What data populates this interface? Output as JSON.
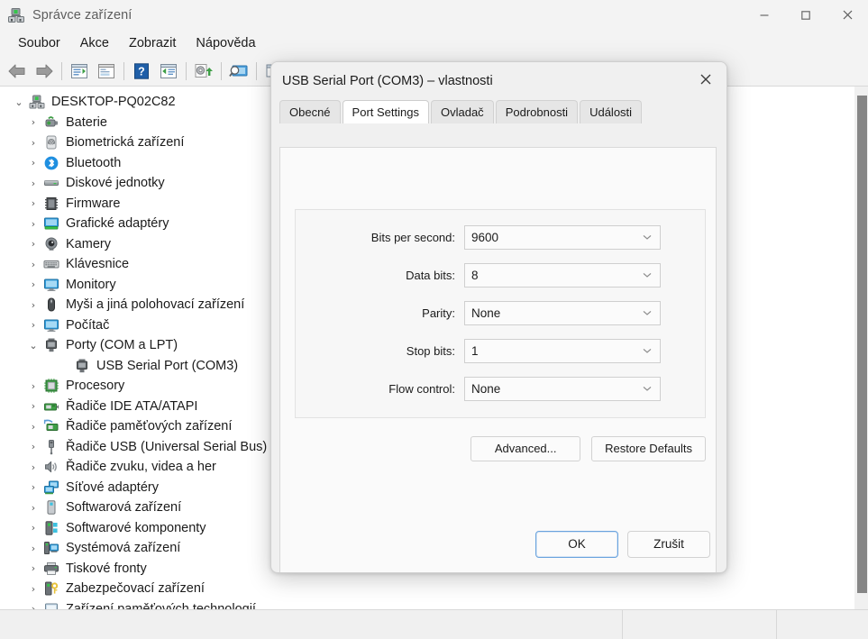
{
  "window": {
    "title": "Správce zařízení",
    "icon": "device-manager-icon",
    "controls": {
      "minimize": "—",
      "maximize": "□",
      "close": "✕"
    }
  },
  "menubar": {
    "items": [
      {
        "label": "Soubor"
      },
      {
        "label": "Akce"
      },
      {
        "label": "Zobrazit"
      },
      {
        "label": "Nápověda"
      }
    ]
  },
  "toolbar": {
    "buttons": [
      {
        "name": "back-icon"
      },
      {
        "name": "forward-icon"
      },
      {
        "name": "properties-icon"
      },
      {
        "name": "show-hidden-icon"
      },
      {
        "name": "help-icon"
      },
      {
        "name": "scan-hardware-icon"
      },
      {
        "name": "update-driver-icon"
      },
      {
        "name": "console-icon"
      },
      {
        "name": "disable-device-icon"
      }
    ]
  },
  "tree": {
    "nodes": [
      {
        "label": "DESKTOP-PQ02C82",
        "level": 0,
        "twisty": "expanded",
        "icon": "computer-icon"
      },
      {
        "label": "Baterie",
        "level": 1,
        "twisty": "collapsed",
        "icon": "battery-icon"
      },
      {
        "label": "Biometrická zařízení",
        "level": 1,
        "twisty": "collapsed",
        "icon": "fingerprint-icon"
      },
      {
        "label": "Bluetooth",
        "level": 1,
        "twisty": "collapsed",
        "icon": "bluetooth-icon"
      },
      {
        "label": "Diskové jednotky",
        "level": 1,
        "twisty": "collapsed",
        "icon": "disk-drive-icon"
      },
      {
        "label": "Firmware",
        "level": 1,
        "twisty": "collapsed",
        "icon": "firmware-icon"
      },
      {
        "label": "Grafické adaptéry",
        "level": 1,
        "twisty": "collapsed",
        "icon": "display-adapter-icon"
      },
      {
        "label": "Kamery",
        "level": 1,
        "twisty": "collapsed",
        "icon": "camera-icon"
      },
      {
        "label": "Klávesnice",
        "level": 1,
        "twisty": "collapsed",
        "icon": "keyboard-icon"
      },
      {
        "label": "Monitory",
        "level": 1,
        "twisty": "collapsed",
        "icon": "monitor-icon"
      },
      {
        "label": "Myši a jiná polohovací zařízení",
        "level": 1,
        "twisty": "collapsed",
        "icon": "mouse-icon"
      },
      {
        "label": "Počítač",
        "level": 1,
        "twisty": "collapsed",
        "icon": "computer-device-icon"
      },
      {
        "label": "Porty (COM a LPT)",
        "level": 1,
        "twisty": "expanded",
        "icon": "port-icon"
      },
      {
        "label": "USB Serial Port (COM3)",
        "level": 2,
        "twisty": "",
        "icon": "port-icon"
      },
      {
        "label": "Procesory",
        "level": 1,
        "twisty": "collapsed",
        "icon": "processor-icon"
      },
      {
        "label": "Řadiče IDE ATA/ATAPI",
        "level": 1,
        "twisty": "collapsed",
        "icon": "ide-controller-icon"
      },
      {
        "label": "Řadiče paměťových zařízení",
        "level": 1,
        "twisty": "collapsed",
        "icon": "storage-controller-icon"
      },
      {
        "label": "Řadiče USB (Universal Serial Bus)",
        "level": 1,
        "twisty": "collapsed",
        "icon": "usb-controller-icon"
      },
      {
        "label": "Řadiče zvuku, videa a her",
        "level": 1,
        "twisty": "collapsed",
        "icon": "sound-icon"
      },
      {
        "label": "Síťové adaptéry",
        "level": 1,
        "twisty": "collapsed",
        "icon": "network-adapter-icon"
      },
      {
        "label": "Softwarová zařízení",
        "level": 1,
        "twisty": "collapsed",
        "icon": "software-device-icon"
      },
      {
        "label": "Softwarové komponenty",
        "level": 1,
        "twisty": "collapsed",
        "icon": "software-component-icon"
      },
      {
        "label": "Systémová zařízení",
        "level": 1,
        "twisty": "collapsed",
        "icon": "system-device-icon"
      },
      {
        "label": "Tiskové fronty",
        "level": 1,
        "twisty": "collapsed",
        "icon": "printer-icon"
      },
      {
        "label": "Zabezpečovací zařízení",
        "level": 1,
        "twisty": "collapsed",
        "icon": "security-device-icon"
      },
      {
        "label": "Zařízení paměťových technologií",
        "level": 1,
        "twisty": "collapsed",
        "icon": "memory-technology-icon"
      }
    ]
  },
  "dialog": {
    "title": "USB Serial Port (COM3) – vlastnosti",
    "close_icon": "close-icon",
    "tabs": [
      {
        "label": "Obecné",
        "active": false
      },
      {
        "label": "Port Settings",
        "active": true
      },
      {
        "label": "Ovladač",
        "active": false
      },
      {
        "label": "Podrobnosti",
        "active": false
      },
      {
        "label": "Události",
        "active": false
      }
    ],
    "fields": [
      {
        "label": "Bits per second:",
        "value": "9600",
        "name": "bits-per-second"
      },
      {
        "label": "Data bits:",
        "value": "8",
        "name": "data-bits"
      },
      {
        "label": "Parity:",
        "value": "None",
        "name": "parity"
      },
      {
        "label": "Stop bits:",
        "value": "1",
        "name": "stop-bits"
      },
      {
        "label": "Flow control:",
        "value": "None",
        "name": "flow-control"
      }
    ],
    "advanced_label": "Advanced...",
    "restore_label": "Restore Defaults",
    "ok_label": "OK",
    "cancel_label": "Zrušit"
  },
  "colors": {
    "accent": "#6aa3de",
    "window_bg": "#f3f3f3",
    "dialog_bg": "#f0f0f0",
    "text": "#1b1b1b",
    "scrollbar_thumb": "#868686"
  }
}
